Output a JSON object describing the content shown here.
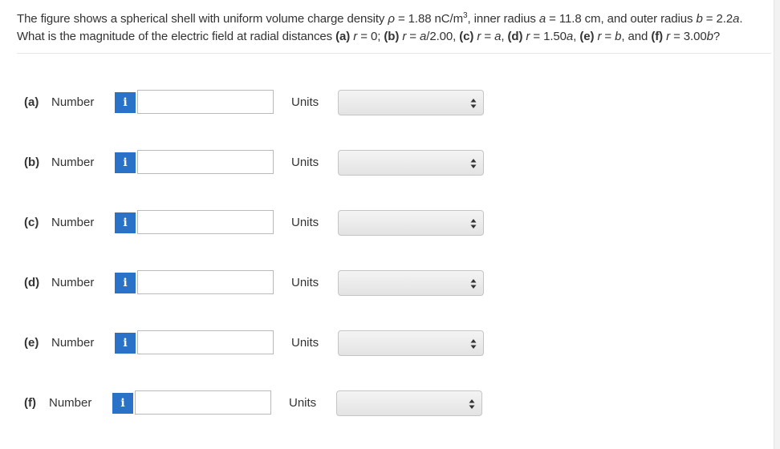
{
  "question": {
    "t1": "The figure shows a spherical shell with uniform volume charge density ",
    "rho": "ρ",
    "t2": " = 1.88 nC/m",
    "sup": "3",
    "t3": ", inner radius ",
    "a1": "a",
    "t4": " = 11.8 cm, and outer radius ",
    "b1": "b",
    "t5": " = 2.2",
    "a2": "a",
    "t6": ". What is the magnitude of the electric field at radial distances ",
    "pa": "(a)",
    "ra": "r",
    "va": " = 0; ",
    "pb": "(b)",
    "rb": "r",
    "vb1": " = ",
    "ab": "a",
    "vb2": "/2.00, ",
    "pc": "(c)",
    "rc": "r",
    "vc1": " = ",
    "ac": "a",
    "vc2": ", ",
    "pd": "(d)",
    "rd": "r",
    "vd1": " = 1.50",
    "ad": "a",
    "vd2": ", ",
    "pe": "(e)",
    "re": "r",
    "ve1": " = ",
    "be": "b",
    "ve2": ", and ",
    "pf": "(f)",
    "rf": "r",
    "vf1": " = 3.00",
    "bf": "b",
    "vf2": "?"
  },
  "parts": [
    {
      "letter": "(a)",
      "number_label": "Number",
      "info": "i",
      "value": "",
      "units_label": "Units",
      "units_value": ""
    },
    {
      "letter": "(b)",
      "number_label": "Number",
      "info": "i",
      "value": "",
      "units_label": "Units",
      "units_value": ""
    },
    {
      "letter": "(c)",
      "number_label": "Number",
      "info": "i",
      "value": "",
      "units_label": "Units",
      "units_value": ""
    },
    {
      "letter": "(d)",
      "number_label": "Number",
      "info": "i",
      "value": "",
      "units_label": "Units",
      "units_value": ""
    },
    {
      "letter": "(e)",
      "number_label": "Number",
      "info": "i",
      "value": "",
      "units_label": "Units",
      "units_value": ""
    },
    {
      "letter": "(f)",
      "number_label": "Number",
      "info": "i",
      "value": "",
      "units_label": "Units",
      "units_value": ""
    }
  ],
  "colors": {
    "info_button": "#2a72c8",
    "text": "#333333",
    "input_border": "#b9b9b9"
  },
  "icons": {
    "info": "info-icon",
    "select": "updown-arrows-icon"
  }
}
